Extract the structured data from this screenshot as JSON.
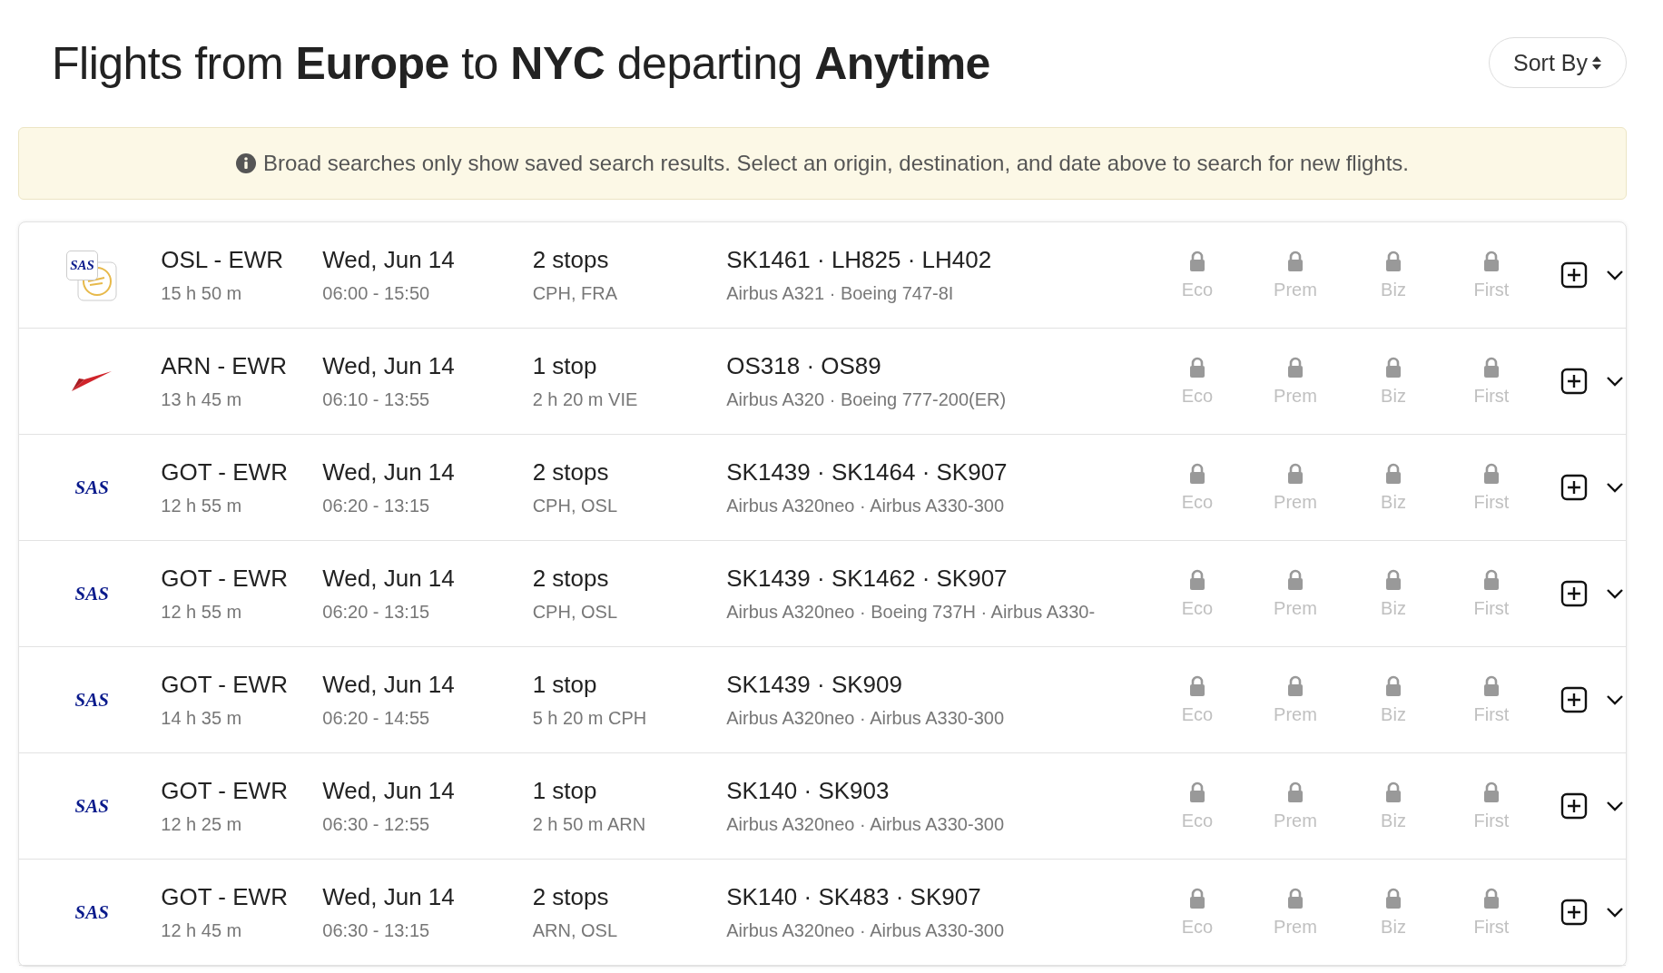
{
  "header": {
    "title": "Flights from **Europe** to **NYC** departing **Anytime**",
    "sort_button": "Sort By"
  },
  "notice": {
    "text": "Broad searches only show saved search results. Select an origin, destination, and date above to search for new flights."
  },
  "flights": [
    {
      "logo": {
        "kind": "sas-lufthansa",
        "text": "SAS"
      },
      "route": "OSL - EWR",
      "duration": "15 h 50 m",
      "date": "Wed, Jun 14",
      "times": "06:00 - 15:50",
      "stops": "2 stops",
      "stop_detail": "CPH, FRA",
      "flight_numbers": "SK1461  ·  LH825  ·  LH402",
      "aircraft": "Airbus A321  ·  Boeing 747-8I",
      "cabins": [
        {
          "label": "Eco",
          "locked": true
        },
        {
          "label": "Prem",
          "locked": true
        },
        {
          "label": "Biz",
          "locked": true
        },
        {
          "label": "First",
          "locked": true
        }
      ]
    },
    {
      "logo": {
        "kind": "austrian"
      },
      "route": "ARN - EWR",
      "duration": "13 h 45 m",
      "date": "Wed, Jun 14",
      "times": "06:10 - 13:55",
      "stops": "1 stop",
      "stop_detail": "2 h 20 m  VIE",
      "flight_numbers": "OS318  ·  OS89",
      "aircraft": "Airbus A320  ·  Boeing 777-200(ER)",
      "cabins": [
        {
          "label": "Eco",
          "locked": true
        },
        {
          "label": "Prem",
          "locked": true
        },
        {
          "label": "Biz",
          "locked": true
        },
        {
          "label": "First",
          "locked": true
        }
      ]
    },
    {
      "logo": {
        "kind": "sas",
        "text": "SAS"
      },
      "route": "GOT - EWR",
      "duration": "12 h 55 m",
      "date": "Wed, Jun 14",
      "times": "06:20 - 13:15",
      "stops": "2 stops",
      "stop_detail": "CPH, OSL",
      "flight_numbers": "SK1439  ·  SK1464  ·  SK907",
      "aircraft": "Airbus A320neo  ·  Airbus A330-300",
      "cabins": [
        {
          "label": "Eco",
          "locked": true
        },
        {
          "label": "Prem",
          "locked": true
        },
        {
          "label": "Biz",
          "locked": true
        },
        {
          "label": "First",
          "locked": true
        }
      ]
    },
    {
      "logo": {
        "kind": "sas",
        "text": "SAS"
      },
      "route": "GOT - EWR",
      "duration": "12 h 55 m",
      "date": "Wed, Jun 14",
      "times": "06:20 - 13:15",
      "stops": "2 stops",
      "stop_detail": "CPH, OSL",
      "flight_numbers": "SK1439  ·  SK1462  ·  SK907",
      "aircraft": "Airbus A320neo  ·  Boeing 737H  ·  Airbus A330-",
      "cabins": [
        {
          "label": "Eco",
          "locked": true
        },
        {
          "label": "Prem",
          "locked": true
        },
        {
          "label": "Biz",
          "locked": true
        },
        {
          "label": "First",
          "locked": true
        }
      ]
    },
    {
      "logo": {
        "kind": "sas",
        "text": "SAS"
      },
      "route": "GOT - EWR",
      "duration": "14 h 35 m",
      "date": "Wed, Jun 14",
      "times": "06:20 - 14:55",
      "stops": "1 stop",
      "stop_detail": "5 h 20 m  CPH",
      "flight_numbers": "SK1439  ·  SK909",
      "aircraft": "Airbus A320neo  ·  Airbus A330-300",
      "cabins": [
        {
          "label": "Eco",
          "locked": true
        },
        {
          "label": "Prem",
          "locked": true
        },
        {
          "label": "Biz",
          "locked": true
        },
        {
          "label": "First",
          "locked": true
        }
      ]
    },
    {
      "logo": {
        "kind": "sas",
        "text": "SAS"
      },
      "route": "GOT - EWR",
      "duration": "12 h 25 m",
      "date": "Wed, Jun 14",
      "times": "06:30 - 12:55",
      "stops": "1 stop",
      "stop_detail": "2 h 50 m  ARN",
      "flight_numbers": "SK140  ·  SK903",
      "aircraft": "Airbus A320neo  ·  Airbus A330-300",
      "cabins": [
        {
          "label": "Eco",
          "locked": true
        },
        {
          "label": "Prem",
          "locked": true
        },
        {
          "label": "Biz",
          "locked": true
        },
        {
          "label": "First",
          "locked": true
        }
      ]
    },
    {
      "logo": {
        "kind": "sas",
        "text": "SAS"
      },
      "route": "GOT - EWR",
      "duration": "12 h 45 m",
      "date": "Wed, Jun 14",
      "times": "06:30 - 13:15",
      "stops": "2 stops",
      "stop_detail": "ARN, OSL",
      "flight_numbers": "SK140  ·  SK483  ·  SK907",
      "aircraft": "Airbus A320neo  ·  Airbus A330-300",
      "cabins": [
        {
          "label": "Eco",
          "locked": true
        },
        {
          "label": "Prem",
          "locked": true
        },
        {
          "label": "Biz",
          "locked": true
        },
        {
          "label": "First",
          "locked": true
        }
      ]
    }
  ]
}
